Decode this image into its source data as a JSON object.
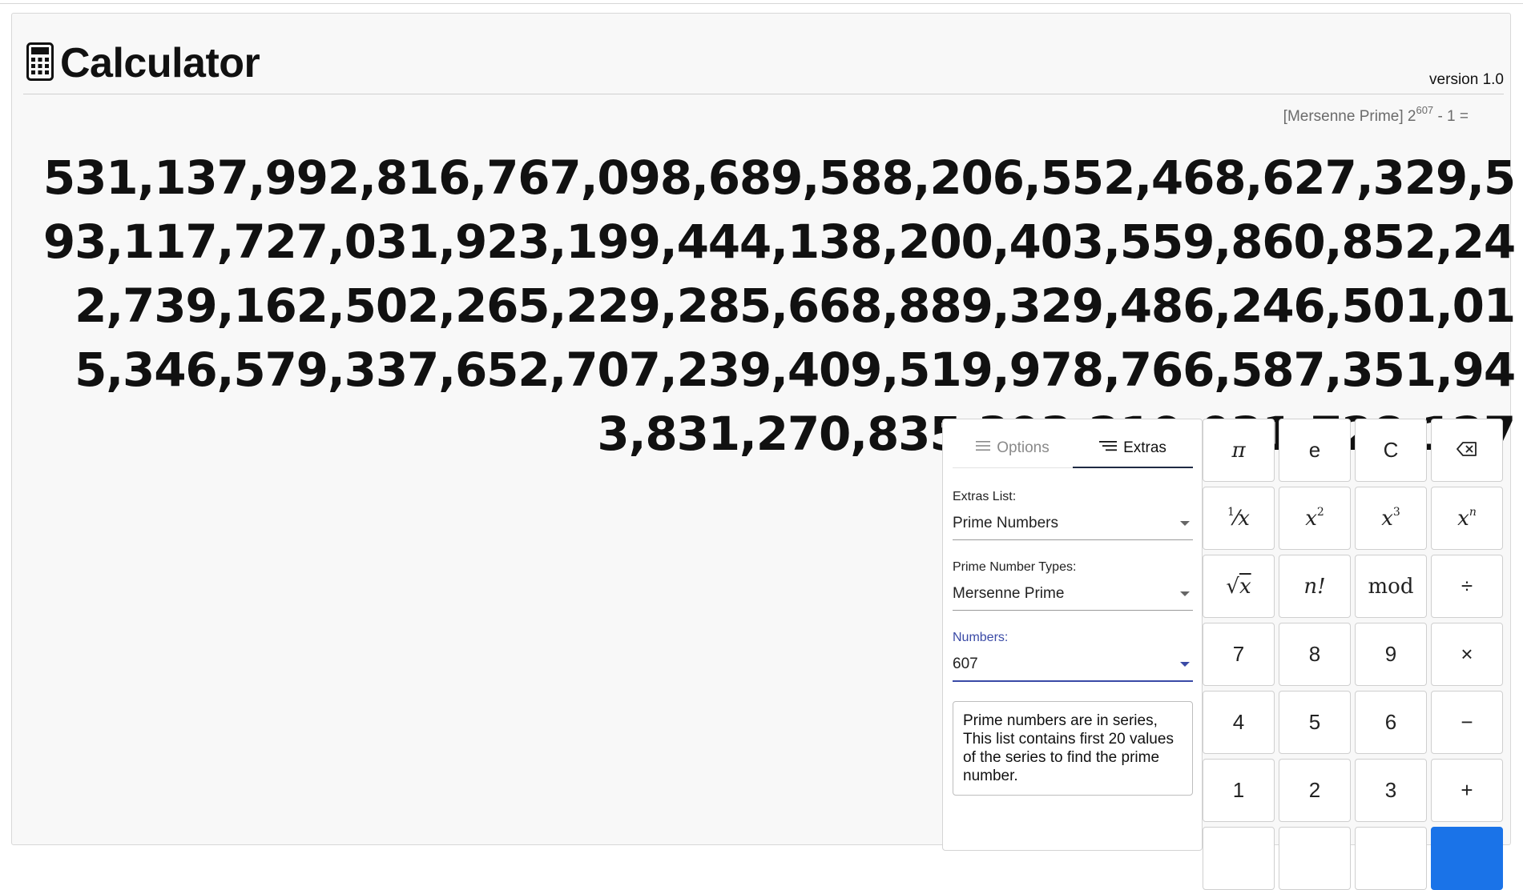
{
  "header": {
    "title": "Calculator",
    "version": "version 1.0",
    "icon": "calculator-icon"
  },
  "display": {
    "expression_prefix": "[Mersenne Prime] 2",
    "expression_exponent": "607",
    "expression_suffix": " - 1 =",
    "result": "531,137,992,816,767,098,689,588,206,552,468,627,329,593,117,727,031,923,199,444,138,200,403,559,860,852,242,739,162,502,265,229,285,668,889,329,486,246,501,015,346,579,337,652,707,239,409,519,978,766,587,351,943,831,270,835,393,219,031,728,127"
  },
  "extras_panel": {
    "tabs": [
      {
        "label": "Options",
        "icon": "menu-icon",
        "active": false
      },
      {
        "label": "Extras",
        "icon": "list-icon",
        "active": true
      }
    ],
    "fields": [
      {
        "label": "Extras List:",
        "value": "Prime Numbers"
      },
      {
        "label": "Prime Number Types:",
        "value": "Mersenne Prime"
      },
      {
        "label": "Numbers:",
        "value": "607"
      }
    ],
    "info": "Prime numbers are in series, This list contains first 20 values of the series to find the prime number."
  },
  "keypad": {
    "row1": [
      "π",
      "e",
      "C",
      "backspace-icon"
    ],
    "row2": [
      "1/x",
      "x²",
      "x³",
      "xⁿ"
    ],
    "row3": [
      "√x",
      "n!",
      "mod",
      "÷"
    ],
    "row4": [
      "7",
      "8",
      "9",
      "×"
    ],
    "row5": [
      "4",
      "5",
      "6",
      "−"
    ],
    "row6": [
      "1",
      "2",
      "3",
      "+"
    ],
    "labels": {
      "pi": "π",
      "e": "e",
      "clear": "C",
      "reciprocal_num": "1",
      "reciprocal_den": "x",
      "x": "x",
      "sq_exp": "2",
      "cube_exp": "3",
      "n_exp": "n",
      "sqrt_x": "x",
      "factorial": "n!",
      "mod": "mod",
      "divide": "÷",
      "seven": "7",
      "eight": "8",
      "nine": "9",
      "multiply": "×",
      "four": "4",
      "five": "5",
      "six": "6",
      "minus": "−",
      "one": "1",
      "two": "2",
      "three": "3",
      "plus": "+"
    },
    "accent_color": "#1a73e8"
  },
  "colors": {
    "active_field": "#3a4aa6",
    "muted_text": "#6b6b6b",
    "panel_bg": "#f8f8f8"
  }
}
